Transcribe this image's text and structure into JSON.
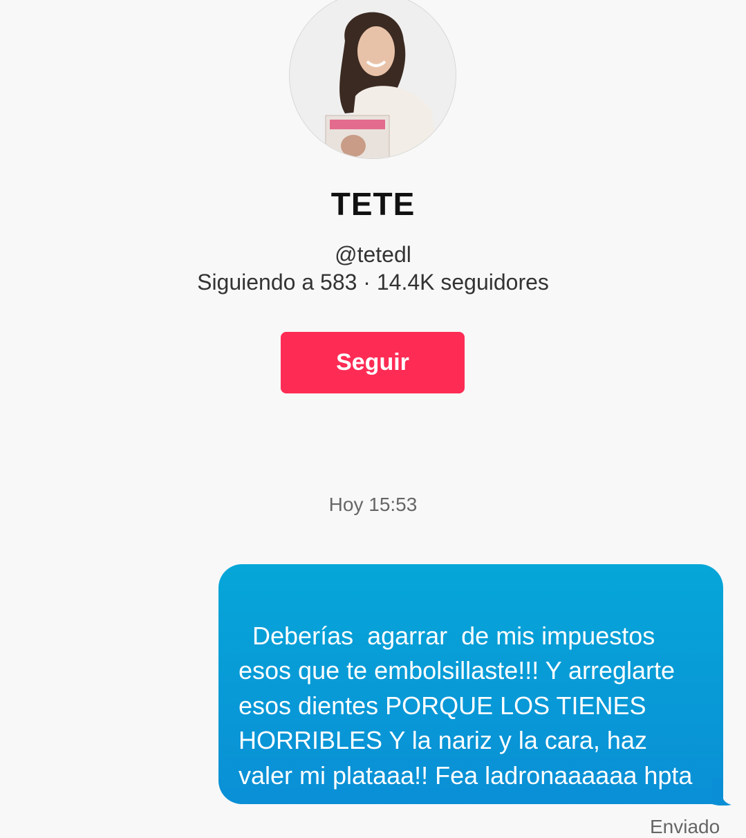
{
  "profile": {
    "avatar_icon": "profile-photo",
    "name": "TETE",
    "handle": "@tetedl",
    "stats": "Siguiendo a 583 · 14.4K seguidores",
    "follow_label": "Seguir"
  },
  "chat": {
    "timestamp": "Hoy 15:53",
    "message": "Deberías  agarrar  de mis impuestos esos que te embolsillaste!!! Y arreglarte esos dientes PORQUE LOS TIENES HORRIBLES Y la nariz y la cara, haz valer mi plataaa!! Fea ladronaaaaaa hpta",
    "status": "Enviado"
  },
  "colors": {
    "follow_button": "#fe2c55",
    "bubble": "#0a9ad6",
    "background": "#f8f8f8"
  }
}
